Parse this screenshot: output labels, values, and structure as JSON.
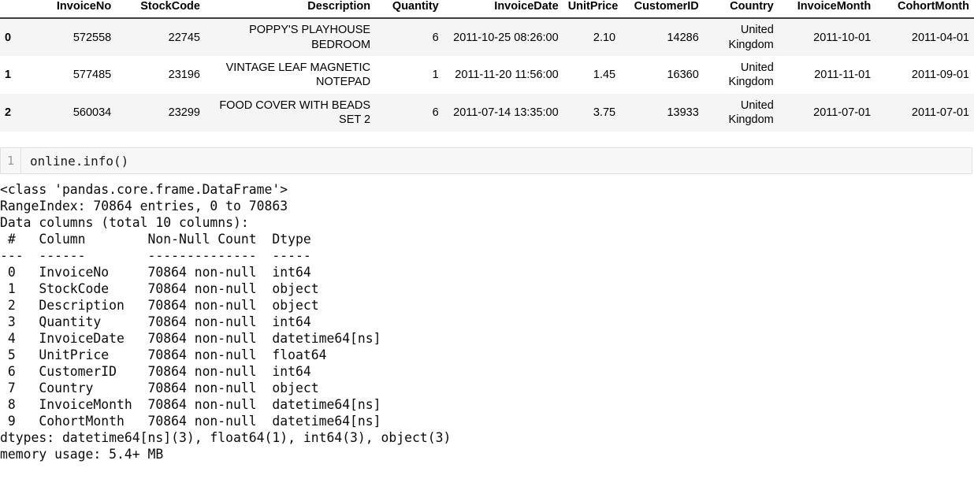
{
  "dataframe": {
    "index_header": "",
    "columns": [
      "InvoiceNo",
      "StockCode",
      "Description",
      "Quantity",
      "InvoiceDate",
      "UnitPrice",
      "CustomerID",
      "Country",
      "InvoiceMonth",
      "CohortMonth"
    ],
    "rows": [
      {
        "index": "0",
        "InvoiceNo": "572558",
        "StockCode": "22745",
        "Description": "POPPY'S PLAYHOUSE BEDROOM",
        "Quantity": "6",
        "InvoiceDate": "2011-10-25 08:26:00",
        "UnitPrice": "2.10",
        "CustomerID": "14286",
        "Country": "United Kingdom",
        "InvoiceMonth": "2011-10-01",
        "CohortMonth": "2011-04-01"
      },
      {
        "index": "1",
        "InvoiceNo": "577485",
        "StockCode": "23196",
        "Description": "VINTAGE LEAF MAGNETIC NOTEPAD",
        "Quantity": "1",
        "InvoiceDate": "2011-11-20 11:56:00",
        "UnitPrice": "1.45",
        "CustomerID": "16360",
        "Country": "United Kingdom",
        "InvoiceMonth": "2011-11-01",
        "CohortMonth": "2011-09-01"
      },
      {
        "index": "2",
        "InvoiceNo": "560034",
        "StockCode": "23299",
        "Description": "FOOD COVER WITH BEADS SET 2",
        "Quantity": "6",
        "InvoiceDate": "2011-07-14 13:35:00",
        "UnitPrice": "3.75",
        "CustomerID": "13933",
        "Country": "United Kingdom",
        "InvoiceMonth": "2011-07-01",
        "CohortMonth": "2011-07-01"
      }
    ]
  },
  "code_cell": {
    "line_number": "1",
    "source": "online.info()"
  },
  "output": {
    "text": "<class 'pandas.core.frame.DataFrame'>\nRangeIndex: 70864 entries, 0 to 70863\nData columns (total 10 columns):\n #   Column        Non-Null Count  Dtype         \n---  ------        --------------  -----         \n 0   InvoiceNo     70864 non-null  int64         \n 1   StockCode     70864 non-null  object        \n 2   Description   70864 non-null  object        \n 3   Quantity      70864 non-null  int64         \n 4   InvoiceDate   70864 non-null  datetime64[ns]\n 5   UnitPrice     70864 non-null  float64       \n 6   CustomerID    70864 non-null  int64         \n 7   Country       70864 non-null  object        \n 8   InvoiceMonth  70864 non-null  datetime64[ns]\n 9   CohortMonth   70864 non-null  datetime64[ns]\ndtypes: datetime64[ns](3), float64(1), int64(3), object(3)\nmemory usage: 5.4+ MB"
  }
}
